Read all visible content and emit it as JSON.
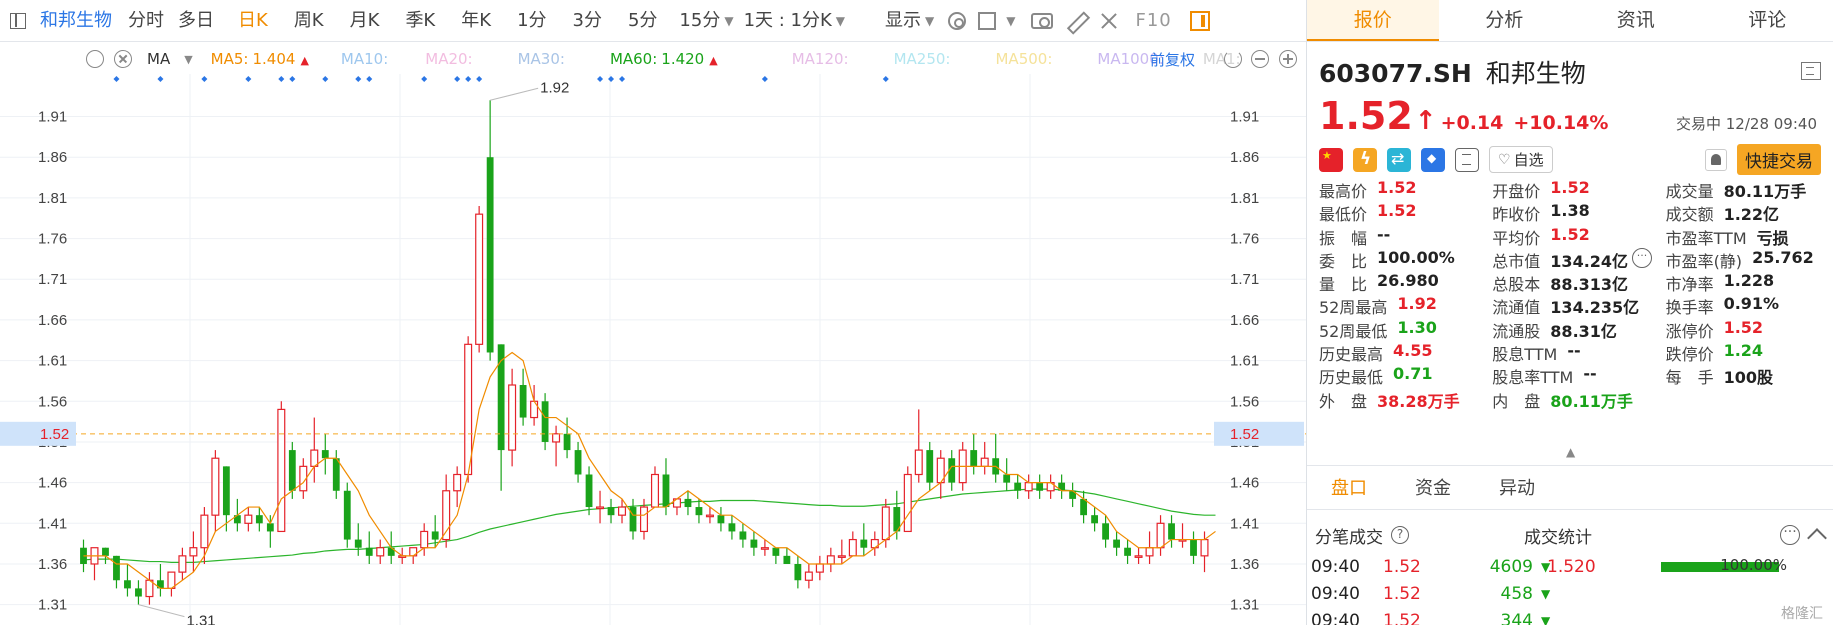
{
  "toolbar": {
    "stock_name": "和邦生物",
    "periods": [
      "分时",
      "多日",
      "日K",
      "周K",
      "月K",
      "季K",
      "年K",
      "1分",
      "3分",
      "5分",
      "15分"
    ],
    "active_period": "日K",
    "interval": "1天 : 1分K",
    "display": "显示",
    "f10": "F10"
  },
  "ma_bar": {
    "ma_label": "MA",
    "items": [
      {
        "label": "MA5:",
        "value": "1.404",
        "arrow": "▲",
        "color": "#f08c00"
      },
      {
        "label": "MA10:",
        "value": "",
        "arrow": "",
        "color": "#9ec7ee"
      },
      {
        "label": "MA20:",
        "value": "",
        "arrow": "",
        "color": "#f2bde0"
      },
      {
        "label": "MA30:",
        "value": "",
        "arrow": "",
        "color": "#a9c4e6"
      },
      {
        "label": "MA60:",
        "value": "1.420",
        "arrow": "▲",
        "color": "#1aa31a"
      },
      {
        "label": "MA120:",
        "value": "",
        "arrow": "",
        "color": "#e6bde6"
      },
      {
        "label": "MA250:",
        "value": "",
        "arrow": "",
        "color": "#b3e6f0"
      },
      {
        "label": "MA500:",
        "value": "",
        "arrow": "",
        "color": "#f5e29a"
      },
      {
        "label": "MA1000:",
        "value": "",
        "arrow": "",
        "color": "#c9b8f0"
      },
      {
        "label": "MA1:",
        "value": "",
        "arrow": "",
        "color": "#d5d5d5"
      }
    ],
    "adjust": "前复权"
  },
  "chart_data": {
    "type": "candlestick",
    "y_ticks": [
      "1.91",
      "1.86",
      "1.81",
      "1.76",
      "1.71",
      "1.66",
      "1.61",
      "1.56",
      "1.51",
      "1.46",
      "1.41",
      "1.36",
      "1.31"
    ],
    "ylim": [
      1.285,
      1.95
    ],
    "current_price": "1.52",
    "high_label": "1.92",
    "low_label": "1.31",
    "candles": [
      [
        1.38,
        1.39,
        1.35,
        1.36
      ],
      [
        1.36,
        1.38,
        1.34,
        1.38
      ],
      [
        1.38,
        1.38,
        1.36,
        1.37
      ],
      [
        1.37,
        1.37,
        1.33,
        1.34
      ],
      [
        1.34,
        1.36,
        1.32,
        1.33
      ],
      [
        1.33,
        1.34,
        1.31,
        1.32
      ],
      [
        1.32,
        1.35,
        1.31,
        1.34
      ],
      [
        1.34,
        1.36,
        1.32,
        1.33
      ],
      [
        1.33,
        1.35,
        1.32,
        1.35
      ],
      [
        1.35,
        1.38,
        1.34,
        1.37
      ],
      [
        1.37,
        1.4,
        1.35,
        1.38
      ],
      [
        1.38,
        1.43,
        1.36,
        1.42
      ],
      [
        1.42,
        1.5,
        1.4,
        1.49
      ],
      [
        1.48,
        1.48,
        1.4,
        1.42
      ],
      [
        1.42,
        1.44,
        1.4,
        1.41
      ],
      [
        1.41,
        1.43,
        1.4,
        1.42
      ],
      [
        1.42,
        1.43,
        1.4,
        1.41
      ],
      [
        1.41,
        1.42,
        1.38,
        1.4
      ],
      [
        1.4,
        1.56,
        1.4,
        1.55
      ],
      [
        1.5,
        1.51,
        1.44,
        1.45
      ],
      [
        1.45,
        1.49,
        1.44,
        1.48
      ],
      [
        1.48,
        1.54,
        1.46,
        1.5
      ],
      [
        1.5,
        1.52,
        1.47,
        1.49
      ],
      [
        1.49,
        1.5,
        1.44,
        1.45
      ],
      [
        1.45,
        1.46,
        1.38,
        1.39
      ],
      [
        1.39,
        1.41,
        1.37,
        1.38
      ],
      [
        1.38,
        1.4,
        1.36,
        1.37
      ],
      [
        1.37,
        1.39,
        1.36,
        1.38
      ],
      [
        1.38,
        1.4,
        1.36,
        1.37
      ],
      [
        1.37,
        1.38,
        1.36,
        1.37
      ],
      [
        1.37,
        1.38,
        1.36,
        1.38
      ],
      [
        1.38,
        1.41,
        1.37,
        1.4
      ],
      [
        1.4,
        1.42,
        1.38,
        1.39
      ],
      [
        1.39,
        1.47,
        1.38,
        1.45
      ],
      [
        1.45,
        1.48,
        1.43,
        1.47
      ],
      [
        1.47,
        1.64,
        1.46,
        1.63
      ],
      [
        1.63,
        1.8,
        1.62,
        1.79
      ],
      [
        1.86,
        1.93,
        1.61,
        1.62
      ],
      [
        1.63,
        1.63,
        1.45,
        1.5
      ],
      [
        1.5,
        1.6,
        1.48,
        1.58
      ],
      [
        1.58,
        1.6,
        1.53,
        1.54
      ],
      [
        1.54,
        1.58,
        1.53,
        1.56
      ],
      [
        1.56,
        1.57,
        1.5,
        1.51
      ],
      [
        1.51,
        1.53,
        1.48,
        1.52
      ],
      [
        1.52,
        1.54,
        1.49,
        1.5
      ],
      [
        1.5,
        1.51,
        1.46,
        1.47
      ],
      [
        1.47,
        1.48,
        1.42,
        1.43
      ],
      [
        1.43,
        1.45,
        1.41,
        1.43
      ],
      [
        1.43,
        1.44,
        1.41,
        1.42
      ],
      [
        1.42,
        1.44,
        1.41,
        1.43
      ],
      [
        1.43,
        1.44,
        1.39,
        1.4
      ],
      [
        1.4,
        1.44,
        1.39,
        1.43
      ],
      [
        1.43,
        1.48,
        1.43,
        1.47
      ],
      [
        1.47,
        1.49,
        1.42,
        1.43
      ],
      [
        1.43,
        1.44,
        1.42,
        1.44
      ],
      [
        1.44,
        1.45,
        1.42,
        1.43
      ],
      [
        1.43,
        1.44,
        1.41,
        1.42
      ],
      [
        1.42,
        1.43,
        1.41,
        1.42
      ],
      [
        1.42,
        1.43,
        1.4,
        1.41
      ],
      [
        1.41,
        1.42,
        1.39,
        1.4
      ],
      [
        1.4,
        1.41,
        1.38,
        1.39
      ],
      [
        1.39,
        1.4,
        1.37,
        1.38
      ],
      [
        1.38,
        1.39,
        1.37,
        1.38
      ],
      [
        1.38,
        1.38,
        1.36,
        1.37
      ],
      [
        1.37,
        1.38,
        1.36,
        1.36
      ],
      [
        1.36,
        1.37,
        1.33,
        1.34
      ],
      [
        1.34,
        1.36,
        1.33,
        1.35
      ],
      [
        1.35,
        1.37,
        1.34,
        1.36
      ],
      [
        1.36,
        1.38,
        1.35,
        1.37
      ],
      [
        1.37,
        1.39,
        1.36,
        1.37
      ],
      [
        1.37,
        1.4,
        1.37,
        1.39
      ],
      [
        1.39,
        1.41,
        1.37,
        1.38
      ],
      [
        1.38,
        1.4,
        1.37,
        1.39
      ],
      [
        1.39,
        1.44,
        1.38,
        1.43
      ],
      [
        1.43,
        1.45,
        1.39,
        1.4
      ],
      [
        1.4,
        1.48,
        1.4,
        1.47
      ],
      [
        1.47,
        1.55,
        1.46,
        1.5
      ],
      [
        1.5,
        1.51,
        1.45,
        1.46
      ],
      [
        1.46,
        1.5,
        1.44,
        1.49
      ],
      [
        1.49,
        1.5,
        1.45,
        1.46
      ],
      [
        1.46,
        1.51,
        1.45,
        1.5
      ],
      [
        1.5,
        1.52,
        1.47,
        1.48
      ],
      [
        1.48,
        1.51,
        1.47,
        1.49
      ],
      [
        1.49,
        1.52,
        1.46,
        1.47
      ],
      [
        1.47,
        1.49,
        1.45,
        1.46
      ],
      [
        1.46,
        1.47,
        1.44,
        1.45
      ],
      [
        1.45,
        1.47,
        1.44,
        1.46
      ],
      [
        1.46,
        1.47,
        1.44,
        1.45
      ],
      [
        1.45,
        1.47,
        1.44,
        1.46
      ],
      [
        1.46,
        1.47,
        1.44,
        1.45
      ],
      [
        1.45,
        1.46,
        1.43,
        1.44
      ],
      [
        1.44,
        1.45,
        1.41,
        1.42
      ],
      [
        1.42,
        1.43,
        1.4,
        1.41
      ],
      [
        1.41,
        1.42,
        1.38,
        1.39
      ],
      [
        1.39,
        1.4,
        1.37,
        1.38
      ],
      [
        1.38,
        1.39,
        1.36,
        1.37
      ],
      [
        1.37,
        1.38,
        1.36,
        1.37
      ],
      [
        1.37,
        1.4,
        1.36,
        1.38
      ],
      [
        1.38,
        1.42,
        1.37,
        1.41
      ],
      [
        1.41,
        1.42,
        1.38,
        1.39
      ],
      [
        1.39,
        1.41,
        1.38,
        1.39
      ],
      [
        1.39,
        1.4,
        1.36,
        1.37
      ],
      [
        1.37,
        1.4,
        1.35,
        1.39
      ]
    ],
    "ma5": [
      1.37,
      1.37,
      1.37,
      1.36,
      1.36,
      1.35,
      1.34,
      1.33,
      1.33,
      1.34,
      1.35,
      1.37,
      1.4,
      1.41,
      1.42,
      1.43,
      1.43,
      1.41,
      1.44,
      1.45,
      1.46,
      1.48,
      1.49,
      1.49,
      1.47,
      1.45,
      1.42,
      1.4,
      1.38,
      1.37,
      1.37,
      1.38,
      1.38,
      1.4,
      1.42,
      1.47,
      1.55,
      1.59,
      1.61,
      1.62,
      1.61,
      1.56,
      1.54,
      1.54,
      1.53,
      1.52,
      1.49,
      1.47,
      1.45,
      1.44,
      1.42,
      1.42,
      1.43,
      1.43,
      1.44,
      1.45,
      1.44,
      1.43,
      1.42,
      1.42,
      1.41,
      1.4,
      1.39,
      1.38,
      1.38,
      1.37,
      1.36,
      1.36,
      1.36,
      1.36,
      1.37,
      1.37,
      1.38,
      1.39,
      1.4,
      1.42,
      1.44,
      1.45,
      1.46,
      1.48,
      1.48,
      1.48,
      1.48,
      1.48,
      1.47,
      1.47,
      1.46,
      1.46,
      1.46,
      1.45,
      1.45,
      1.44,
      1.43,
      1.42,
      1.4,
      1.39,
      1.38,
      1.38,
      1.38,
      1.39,
      1.39,
      1.39,
      1.39,
      1.4
    ],
    "ma60": [
      1.365,
      1.366,
      1.366,
      1.366,
      1.365,
      1.364,
      1.363,
      1.363,
      1.362,
      1.362,
      1.362,
      1.363,
      1.364,
      1.365,
      1.366,
      1.367,
      1.368,
      1.369,
      1.37,
      1.371,
      1.373,
      1.374,
      1.376,
      1.377,
      1.378,
      1.378,
      1.379,
      1.38,
      1.381,
      1.382,
      1.383,
      1.384,
      1.386,
      1.388,
      1.39,
      1.394,
      1.399,
      1.403,
      1.406,
      1.409,
      1.412,
      1.415,
      1.418,
      1.421,
      1.423,
      1.425,
      1.427,
      1.428,
      1.429,
      1.43,
      1.431,
      1.432,
      1.433,
      1.434,
      1.435,
      1.436,
      1.437,
      1.437,
      1.438,
      1.438,
      1.438,
      1.438,
      1.437,
      1.436,
      1.435,
      1.434,
      1.433,
      1.432,
      1.432,
      1.431,
      1.431,
      1.431,
      1.432,
      1.433,
      1.434,
      1.436,
      1.438,
      1.44,
      1.442,
      1.444,
      1.446,
      1.447,
      1.448,
      1.449,
      1.45,
      1.451,
      1.452,
      1.452,
      1.452,
      1.451,
      1.45,
      1.448,
      1.446,
      1.443,
      1.44,
      1.437,
      1.434,
      1.431,
      1.428,
      1.425,
      1.423,
      1.421,
      1.42,
      1.42
    ]
  },
  "quote": {
    "tabs": [
      "报价",
      "分析",
      "资讯",
      "评论"
    ],
    "code": "603077.SH",
    "name": "和邦生物",
    "price": "1.52",
    "arrow": "🡅",
    "change": "+0.14",
    "change_pct": "+10.14%",
    "status": "交易中 12/28 09:40",
    "watch_label": "自选",
    "trade_label": "快捷交易",
    "rows": [
      [
        {
          "l": "最高价",
          "v": "1.52",
          "c": "up"
        },
        {
          "l": "开盘价",
          "v": "1.52",
          "c": "up"
        },
        {
          "l": "成交量",
          "v": "80.11万手",
          "c": ""
        }
      ],
      [
        {
          "l": "最低价",
          "v": "1.52",
          "c": "up"
        },
        {
          "l": "昨收价",
          "v": "1.38",
          "c": ""
        },
        {
          "l": "成交额",
          "v": "1.22亿",
          "c": ""
        }
      ],
      [
        {
          "l": "振　幅",
          "v": "--",
          "c": ""
        },
        {
          "l": "平均价",
          "v": "1.52",
          "c": "up"
        },
        {
          "l": "市盈率TTM",
          "v": "亏损",
          "c": ""
        }
      ],
      [
        {
          "l": "委　比",
          "v": "100.00%",
          "c": ""
        },
        {
          "l": "总市值",
          "v": "134.24亿",
          "c": ""
        },
        {
          "l": "市盈率(静)",
          "v": "25.762",
          "c": ""
        }
      ],
      [
        {
          "l": "量　比",
          "v": "26.980",
          "c": ""
        },
        {
          "l": "总股本",
          "v": "88.313亿",
          "c": ""
        },
        {
          "l": "市净率",
          "v": "1.228",
          "c": ""
        }
      ],
      [
        {
          "l": "52周最高",
          "v": "1.92",
          "c": "up"
        },
        {
          "l": "流通值",
          "v": "134.235亿",
          "c": ""
        },
        {
          "l": "换手率",
          "v": "0.91%",
          "c": ""
        }
      ],
      [
        {
          "l": "52周最低",
          "v": "1.30",
          "c": "down"
        },
        {
          "l": "流通股",
          "v": "88.31亿",
          "c": ""
        },
        {
          "l": "涨停价",
          "v": "1.52",
          "c": "up"
        }
      ],
      [
        {
          "l": "历史最高",
          "v": "4.55",
          "c": "up"
        },
        {
          "l": "股息TTM",
          "v": "--",
          "c": ""
        },
        {
          "l": "跌停价",
          "v": "1.24",
          "c": "down"
        }
      ],
      [
        {
          "l": "历史最低",
          "v": "0.71",
          "c": "down"
        },
        {
          "l": "股息率TTM",
          "v": "--",
          "c": ""
        },
        {
          "l": "每　手",
          "v": "100股",
          "c": ""
        }
      ],
      [
        {
          "l": "外　盘",
          "v": "38.28万手",
          "c": "up"
        },
        {
          "l": "内　盘",
          "v": "80.11万手",
          "c": "down"
        },
        {
          "l": "",
          "v": "",
          "c": ""
        }
      ]
    ]
  },
  "sub_tabs": [
    "盘口",
    "资金",
    "异动"
  ],
  "ticks": {
    "title": "分笔成交",
    "rows": [
      {
        "time": "09:40",
        "price": "1.52",
        "vol": "4609",
        "dir": "▼"
      },
      {
        "time": "09:40",
        "price": "1.52",
        "vol": "458",
        "dir": "▼"
      },
      {
        "time": "09:40",
        "price": "1.52",
        "vol": "344",
        "dir": "▼"
      }
    ]
  },
  "stats": {
    "title": "成交统计",
    "price": "1.520",
    "pct": "100.00%"
  },
  "watermark": "格隆汇",
  "colors": {
    "up": "#e5222a",
    "down": "#1aa31a",
    "accent": "#f08c00"
  }
}
